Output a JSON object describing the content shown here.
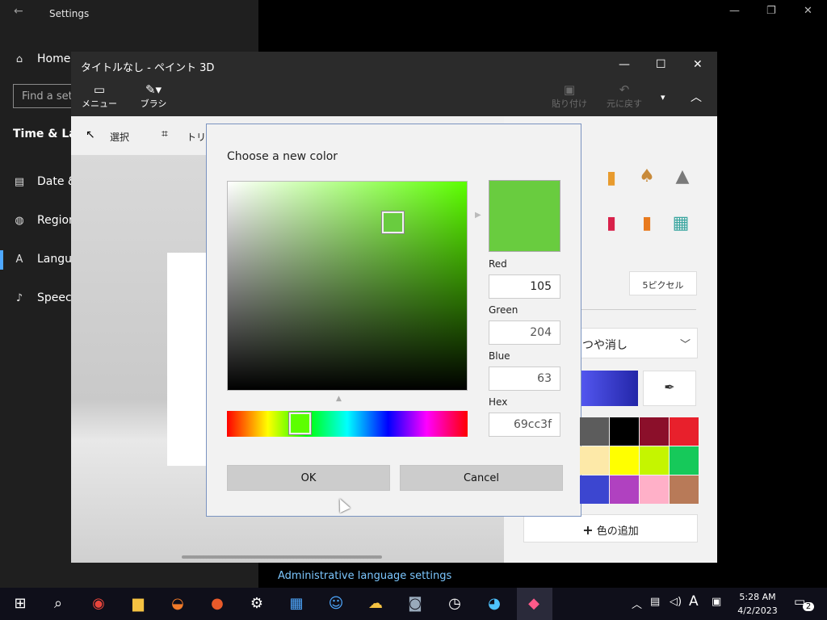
{
  "settings": {
    "title": "Settings",
    "nav": {
      "home": "Home",
      "find_placeholder": "Find a set",
      "section": "Time & Lan",
      "date": "Date &",
      "region": "Region",
      "language": "Langua",
      "speech": "Speech"
    },
    "admin_link": "Administrative language settings"
  },
  "paint": {
    "title": "タイトルなし - ペイント 3D",
    "toolbar": {
      "menu": "メニュー",
      "brush": "ブラシ",
      "paste": "貼り付け",
      "undo": "元に戻す"
    },
    "subbar": {
      "select": "選択",
      "crop": "トリミ"
    },
    "panel": {
      "size": "5ピクセル",
      "finish": "つや消し",
      "add_color": "色の追加",
      "palette": [
        "#5c5c5c",
        "#000000",
        "#8b0f2a",
        "#e8202c",
        "#fde9a8",
        "#ffff00",
        "#c5f500",
        "#16c95a",
        "#3c46d0",
        "#b041c0",
        "#ffb0c8",
        "#b87a58"
      ]
    }
  },
  "dialog": {
    "title": "Choose a new color",
    "fields": {
      "red_label": "Red",
      "red": "105",
      "green_label": "Green",
      "green": "204",
      "blue_label": "Blue",
      "blue": "63",
      "hex_label": "Hex",
      "hex": "69cc3f"
    },
    "ok": "OK",
    "cancel": "Cancel"
  },
  "taskbar": {
    "time": "5:28 AM",
    "date": "4/2/2023",
    "ime": "A",
    "notifications": "2"
  }
}
